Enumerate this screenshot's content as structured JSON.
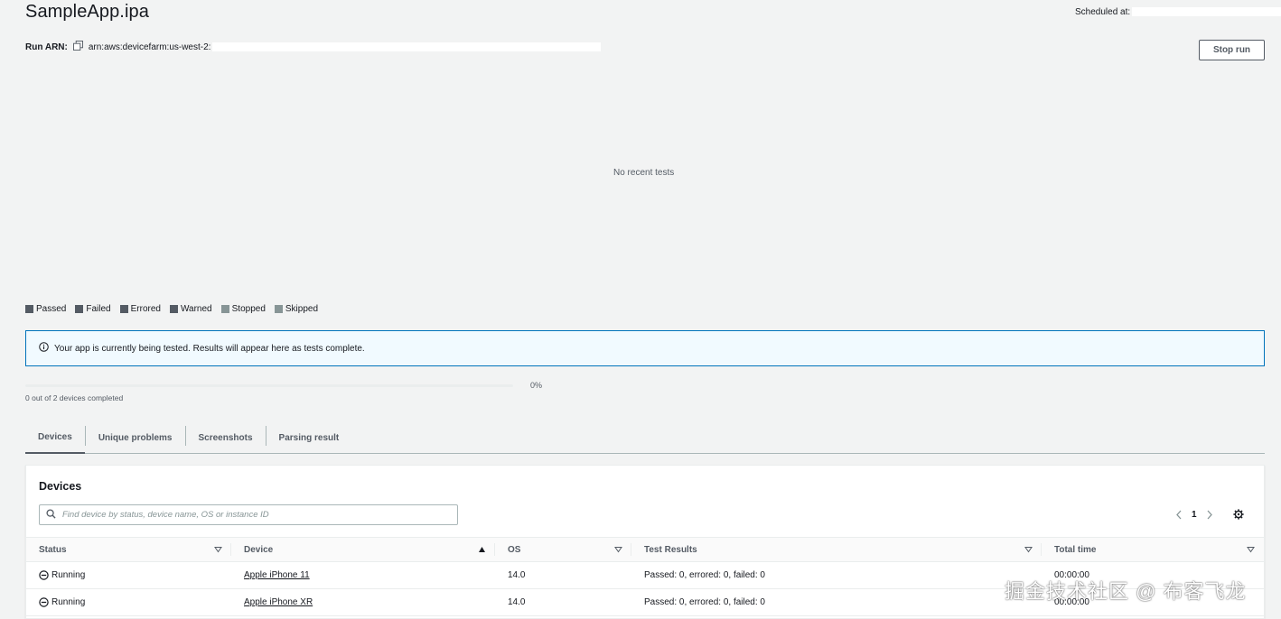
{
  "header": {
    "app_title": "SampleApp.ipa",
    "scheduled_label": "Scheduled at:",
    "run_arn_label": "Run ARN:",
    "run_arn_value": "arn:aws:devicefarm:us-west-2:",
    "stop_button": "Stop run"
  },
  "chart": {
    "empty_message": "No recent tests"
  },
  "legend": [
    {
      "label": "Passed",
      "color": "#545b64"
    },
    {
      "label": "Failed",
      "color": "#545b64"
    },
    {
      "label": "Errored",
      "color": "#545b64"
    },
    {
      "label": "Warned",
      "color": "#545b64"
    },
    {
      "label": "Stopped",
      "color": "#879596"
    },
    {
      "label": "Skipped",
      "color": "#879596"
    }
  ],
  "alert": {
    "message": "Your app is currently being tested. Results will appear here as tests complete."
  },
  "progress": {
    "percent": 0,
    "percent_label": "0%",
    "status": "0 out of 2 devices completed"
  },
  "tabs": [
    {
      "label": "Devices",
      "active": true
    },
    {
      "label": "Unique problems",
      "active": false
    },
    {
      "label": "Screenshots",
      "active": false
    },
    {
      "label": "Parsing result",
      "active": false
    }
  ],
  "devices_panel": {
    "title": "Devices",
    "search_placeholder": "Find device by status, device name, OS or instance ID",
    "page": "1",
    "columns": [
      "Status",
      "Device",
      "OS",
      "Test Results",
      "Total time"
    ],
    "rows": [
      {
        "status": "Running",
        "device": "Apple iPhone 11",
        "os": "14.0",
        "results": "Passed: 0, errored: 0, failed: 0",
        "time": "00:00:00"
      },
      {
        "status": "Running",
        "device": "Apple iPhone XR",
        "os": "14.0",
        "results": "Passed: 0, errored: 0, failed: 0",
        "time": "00:00:00"
      }
    ]
  },
  "colors": {
    "accent": "#0073bb",
    "text": "#16191f",
    "muted": "#545b64",
    "background": "#f2f3f3"
  },
  "watermark": "掘金技术社区 @ 布客飞龙"
}
